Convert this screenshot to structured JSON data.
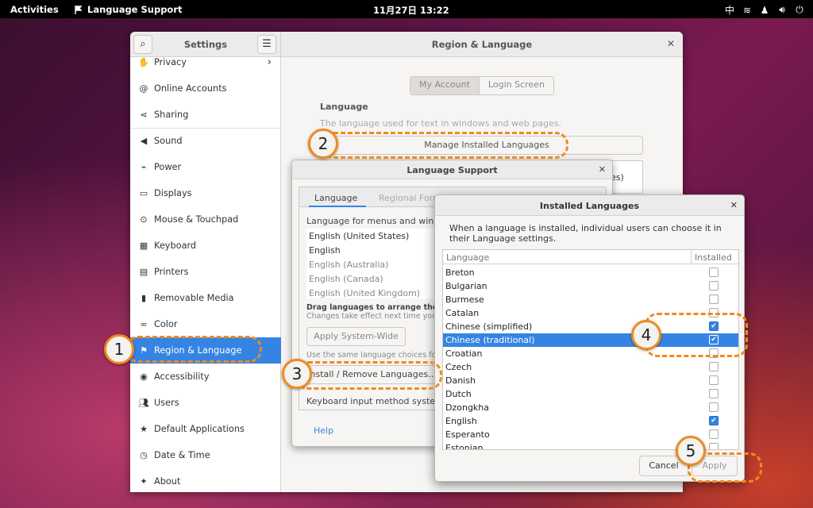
{
  "topbar": {
    "activities": "Activities",
    "app": "Language Support",
    "clock": "11月27日  13:22",
    "input_method": "中"
  },
  "settings": {
    "sidebar_title": "Settings",
    "main_title": "Region & Language",
    "sidebar_items": [
      {
        "label": "Privacy",
        "icon": "hand-icon"
      },
      {
        "label": "Online Accounts",
        "icon": "at-icon"
      },
      {
        "label": "Sharing",
        "icon": "share-icon"
      },
      {
        "label": "Sound",
        "icon": "speaker-icon"
      },
      {
        "label": "Power",
        "icon": "power-icon"
      },
      {
        "label": "Displays",
        "icon": "display-icon"
      },
      {
        "label": "Mouse & Touchpad",
        "icon": "mouse-icon"
      },
      {
        "label": "Keyboard",
        "icon": "keyboard-icon"
      },
      {
        "label": "Printers",
        "icon": "printer-icon"
      },
      {
        "label": "Removable Media",
        "icon": "usb-icon"
      },
      {
        "label": "Color",
        "icon": "color-icon"
      },
      {
        "label": "Region & Language",
        "icon": "flag-icon"
      },
      {
        "label": "Accessibility",
        "icon": "accessibility-icon"
      },
      {
        "label": "Users",
        "icon": "users-icon"
      },
      {
        "label": "Default Applications",
        "icon": "star-icon"
      },
      {
        "label": "Date & Time",
        "icon": "clock-icon"
      },
      {
        "label": "About",
        "icon": "about-icon"
      }
    ],
    "tabs": [
      "My Account",
      "Login Screen"
    ],
    "language_heading": "Language",
    "language_desc": "The language used for text in windows and web pages.",
    "manage_button": "Manage Installed Languages",
    "partial_text": "ates)"
  },
  "language_support": {
    "title": "Language Support",
    "tabs": [
      "Language",
      "Regional Form"
    ],
    "menus_label": "Language for menus and windo",
    "languages": [
      "English (United States)",
      "English",
      "English (Australia)",
      "English (Canada)",
      "English (United Kingdom)"
    ],
    "drag_hint": "Drag languages to arrange them",
    "changes_hint": "Changes take effect next time you lo",
    "apply_system_wide": "Apply System-Wide",
    "same_choices": "Use the same language choices for s",
    "install_remove": "Install / Remove Languages...",
    "keyboard_method": "Keyboard input method system",
    "help": "Help"
  },
  "installed_languages": {
    "title": "Installed Languages",
    "description": "When a language is installed, individual users can choose it in their Language settings.",
    "col_language": "Language",
    "col_installed": "Installed",
    "rows": [
      {
        "name": "Breton",
        "installed": false
      },
      {
        "name": "Bulgarian",
        "installed": false
      },
      {
        "name": "Burmese",
        "installed": false
      },
      {
        "name": "Catalan",
        "installed": false
      },
      {
        "name": "Chinese (simplified)",
        "installed": true
      },
      {
        "name": "Chinese (traditional)",
        "installed": true
      },
      {
        "name": "Croatian",
        "installed": false
      },
      {
        "name": "Czech",
        "installed": false
      },
      {
        "name": "Danish",
        "installed": false
      },
      {
        "name": "Dutch",
        "installed": false
      },
      {
        "name": "Dzongkha",
        "installed": false
      },
      {
        "name": "English",
        "installed": true
      },
      {
        "name": "Esperanto",
        "installed": false
      },
      {
        "name": "Estonian",
        "installed": false
      }
    ],
    "selected_row": "Chinese (traditional)",
    "cancel": "Cancel",
    "apply": "Apply"
  },
  "annotations": [
    "1",
    "2",
    "3",
    "4",
    "5"
  ],
  "colors": {
    "accent": "#3584e4",
    "annotation": "#f08a1c"
  }
}
